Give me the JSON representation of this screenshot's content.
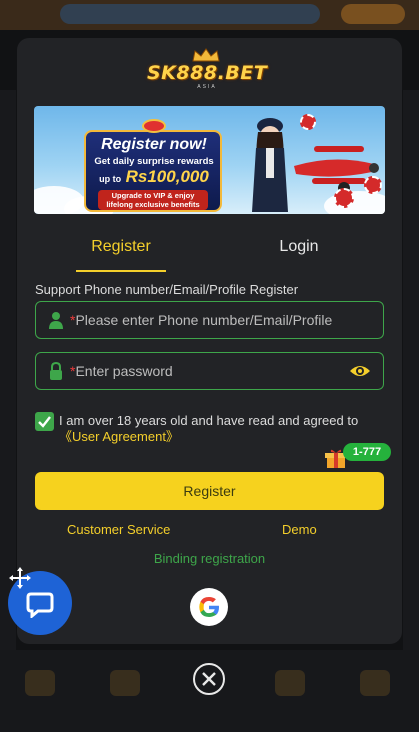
{
  "brand": {
    "logo_text": "SK888.BET",
    "logo_sub": "ASIA"
  },
  "banner": {
    "title": "Register now!",
    "line2": "Get daily surprise rewards",
    "prefix": "up to",
    "amount": "Rs100,000",
    "vip_line1": "Upgrade to VIP & enjoy",
    "vip_line2": "lifelong exclusive benefits"
  },
  "tabs": [
    {
      "label": "Register",
      "active": true
    },
    {
      "label": "Login",
      "active": false
    }
  ],
  "form": {
    "support_label": "Support Phone number/Email/Profile Register",
    "phone": {
      "required_mark": "*",
      "placeholder": "Please enter Phone number/Email/Profile",
      "value": ""
    },
    "password": {
      "required_mark": "*",
      "placeholder": "Enter password",
      "value": ""
    },
    "agree": {
      "checked": true,
      "text": "I am over 18 years old and have read and agreed to",
      "link": "《User Agreement》"
    },
    "register_button": "Register"
  },
  "gift_badge": "1-777",
  "links": {
    "customer_service": "Customer Service",
    "demo": "Demo",
    "binding": "Binding registration"
  },
  "colors": {
    "accent": "#f4cf2b",
    "green": "#3ea64a",
    "modal_bg": "#222326",
    "button": "#f6d21e",
    "chat": "#1e63d6"
  },
  "icons": [
    "user-icon",
    "lock-icon",
    "eye-icon",
    "check-icon",
    "gift-icon",
    "google-icon",
    "close-icon",
    "chat-icon",
    "move-icon"
  ]
}
